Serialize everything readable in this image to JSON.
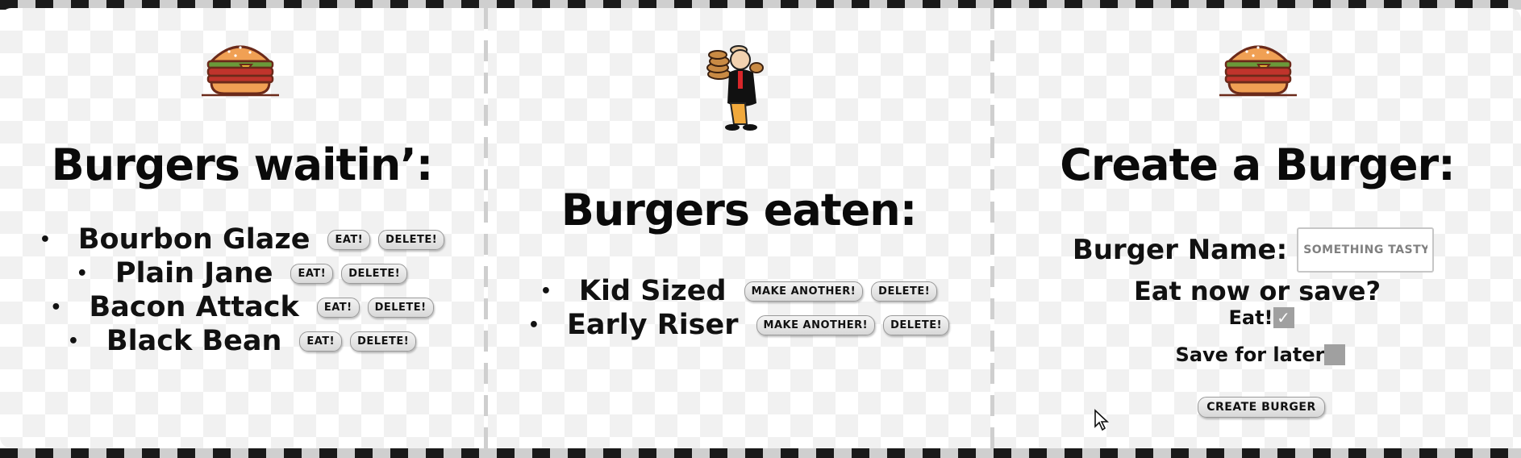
{
  "waiting": {
    "heading": "Burgers waitin’:",
    "items": [
      {
        "name": "Bourbon Glaze",
        "eat_label": "Eat!",
        "delete_label": "Delete!"
      },
      {
        "name": "Plain Jane",
        "eat_label": "Eat!",
        "delete_label": "Delete!"
      },
      {
        "name": "Bacon Attack",
        "eat_label": "Eat!",
        "delete_label": "Delete!"
      },
      {
        "name": "Black Bean",
        "eat_label": "Eat!",
        "delete_label": "Delete!"
      }
    ]
  },
  "eaten": {
    "heading": "Burgers eaten:",
    "items": [
      {
        "name": "Kid Sized",
        "again_label": "Make another!",
        "delete_label": "Delete!"
      },
      {
        "name": "Early Riser",
        "again_label": "Make another!",
        "delete_label": "Delete!"
      }
    ]
  },
  "create": {
    "heading": "Create a Burger:",
    "name_label": "Burger Name:",
    "name_placeholder": "Something tasty",
    "name_value": "",
    "question": "Eat now or save?",
    "eat_option": "Eat!",
    "eat_checked": true,
    "save_option": "Save for later",
    "save_checked": false,
    "submit_label": "Create Burger"
  },
  "icons": {
    "burger": "burger-icon",
    "mascot": "wimpy-mascot-illustration",
    "check": "checkmark-icon",
    "cursor": "mouse-cursor"
  },
  "colors": {
    "bun": "#f0a054",
    "patty": "#c0342c",
    "lettuce": "#6a9a3a",
    "checkbox": "#a0a0a0",
    "heading": "#0a0a0a"
  }
}
